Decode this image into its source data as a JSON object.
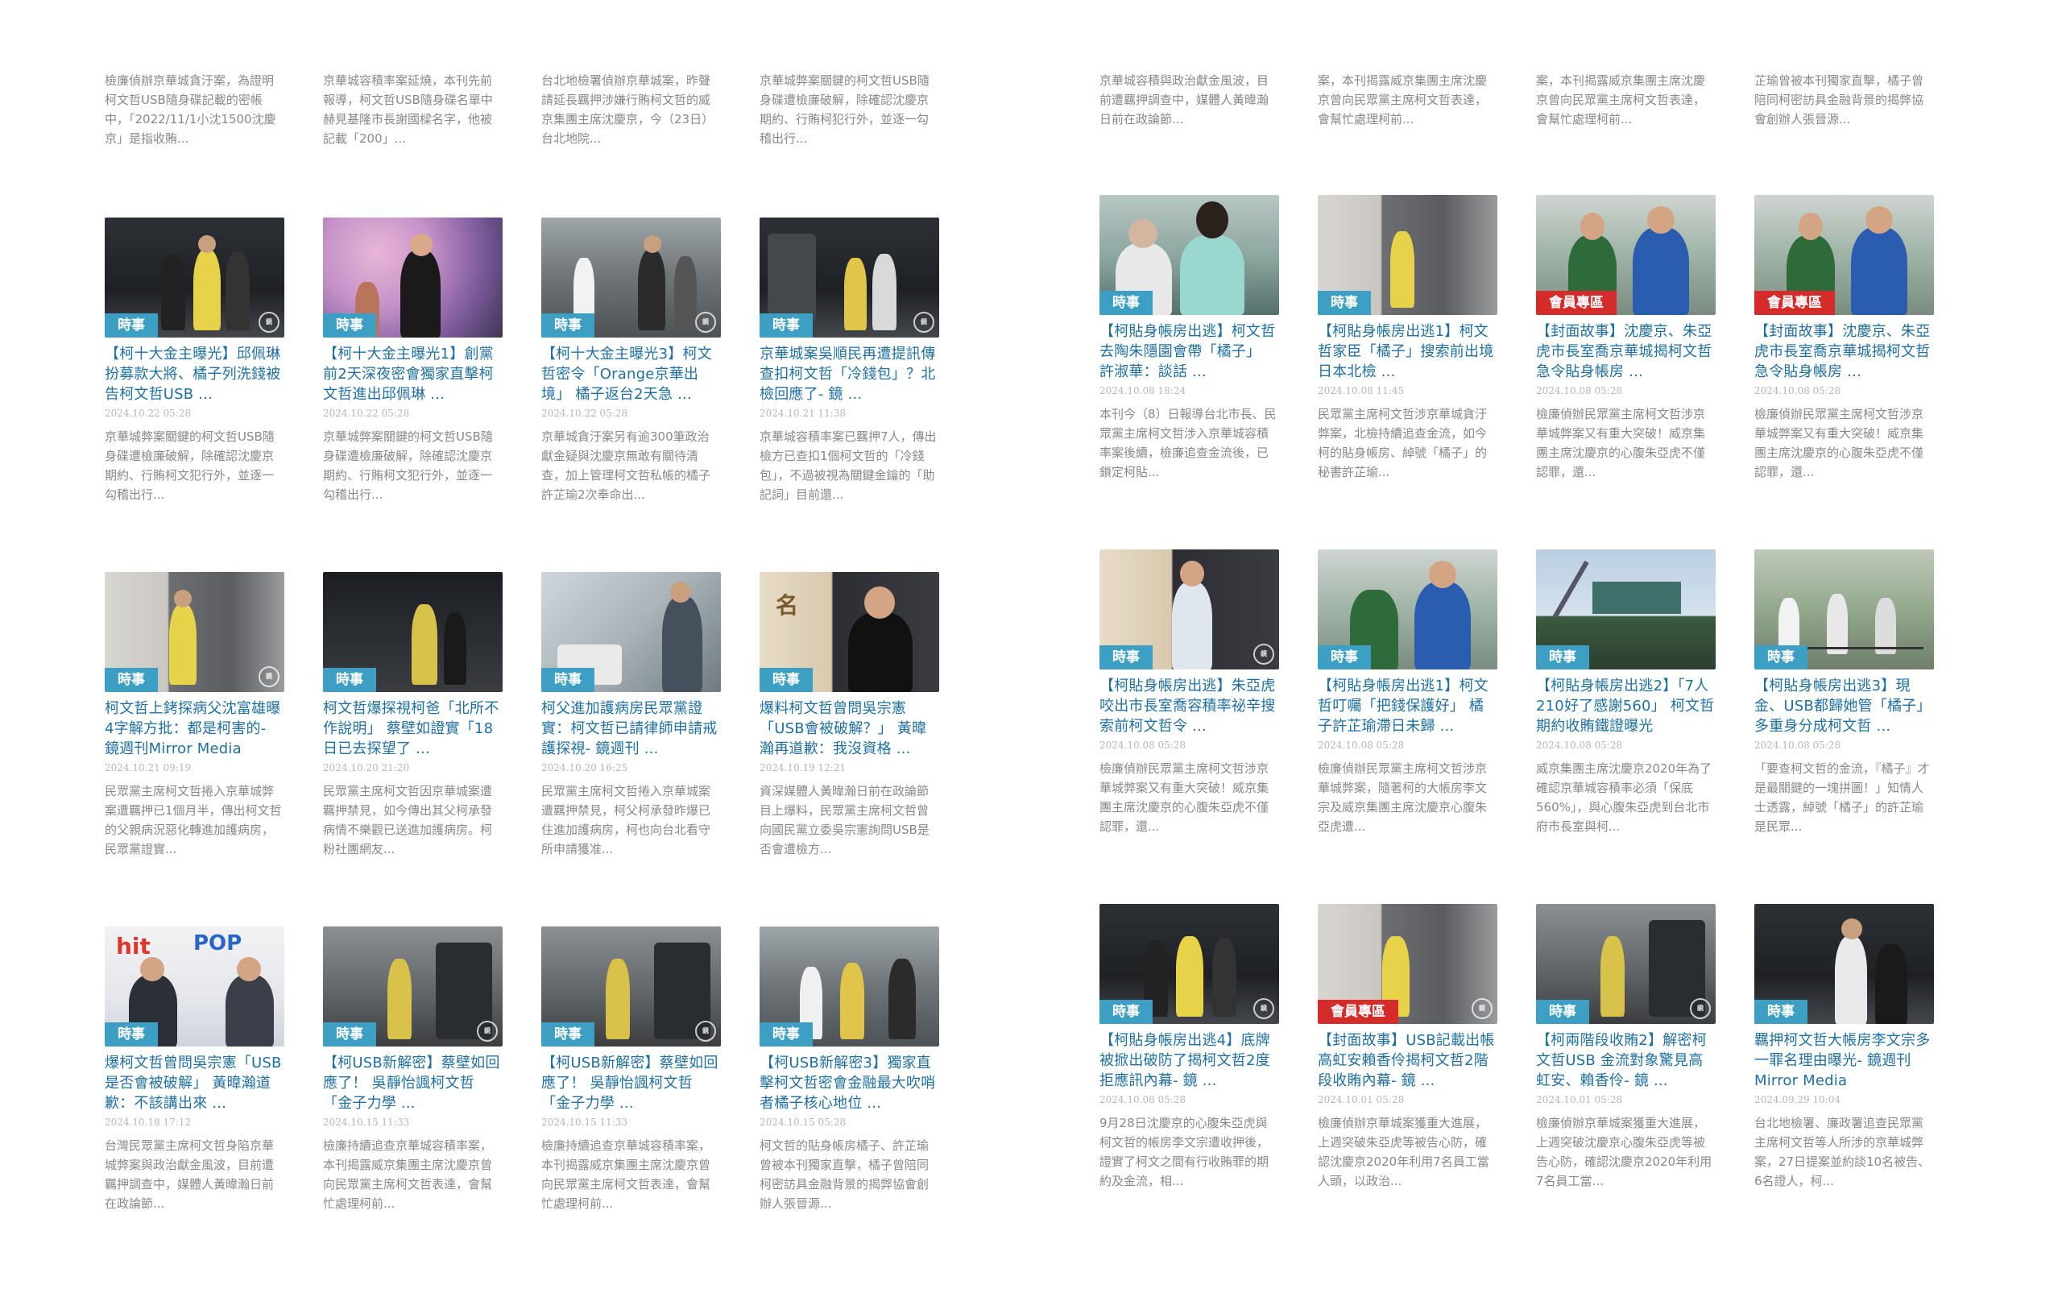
{
  "colors": {
    "category_badge": "#3d9fc4",
    "member_badge": "#d62b2b",
    "title": "#1f6fa3",
    "date": "#b5b5b5",
    "snippet": "#888888"
  },
  "left": {
    "row0": [
      {
        "snippet": "檢廉偵辦京華城貪汙案，為證明柯文哲USB隨身碟記載的密帳中，「2022/11/1小沈1500沈慶京」是指收賄..."
      },
      {
        "snippet": "京華城容積率案延燒，本刊先前報導，柯文哲USB隨身碟名單中赫見基隆市長謝國樑名字，他被記載「200」..."
      },
      {
        "snippet": "台北地檢署偵辦京華城案，昨聲請延長羈押涉嫌行賄柯文哲的威京集團主席沈慶京，今（23日）台北地院..."
      },
      {
        "snippet": "京華城弊案關鍵的柯文哲USB隨身碟遭檢廉破解，除確認沈慶京期約、行賄柯犯行外，並逐一勾稽出行..."
      }
    ],
    "row1": [
      {
        "badge": "時事",
        "title": "【柯十大金主曝光】邱佩琳扮募款大將、橘子列洗錢被告柯文哲USB ...",
        "date": "2024.10.22 05:28",
        "snippet": "京華城弊案關鍵的柯文哲USB隨身碟遭檢廉破解，除確認沈慶京期約、行賄柯文犯行外，並逐一勾稽出行..."
      },
      {
        "badge": "時事",
        "title": "【柯十大金主曝光1】創黨前2天深夜密會獨家直擊柯文哲進出邱佩琳 ...",
        "date": "2024.10.22 05:28",
        "snippet": "京華城弊案關鍵的柯文哲USB隨身碟遭檢廉破解，除確認沈慶京期約、行賄柯文犯行外，並逐一勾稽出行..."
      },
      {
        "badge": "時事",
        "title": "【柯十大金主曝光3】柯文哲密令「Orange京華出境」 橘子返台2天急 ...",
        "date": "2024.10.22 05:28",
        "snippet": "京華城貪汙案另有逾300筆政治獻金疑與沈慶京無敢有關待清查，加上管理柯文哲私帳的橘子許芷瑜2次奉命出..."
      },
      {
        "badge": "時事",
        "title": "京華城案吳順民再遭提訊傳查扣柯文哲「冷錢包」？北檢回應了- 鏡 ...",
        "date": "2024.10.21 11:38",
        "snippet": "京華城容積率案已羈押7人，傳出檢方已查扣1個柯文哲的「冷錢包」，不過被視為關鍵金鑰的「助記詞」目前還..."
      }
    ],
    "row2": [
      {
        "badge": "時事",
        "title": "柯文哲上銬探病父沈富雄曝4字解方批：都是柯害的- 鏡週刊Mirror Media",
        "date": "2024.10.21 09:19",
        "snippet": "民眾黨主席柯文哲捲入京華城弊案遭羈押已1個月半，傳出柯文哲的父親病況惡化轉進加護病房，民眾黨證實..."
      },
      {
        "badge": "時事",
        "title": "柯文哲爆探視柯爸「北所不作說明」 蔡壁如證實「18日已去探望了 ...",
        "date": "2024.10.20 21:20",
        "snippet": "民眾黨主席柯文哲因京華城案遭羈押禁見，如今傳出其父柯承發病情不樂觀已送進加護病房。柯粉社團網友..."
      },
      {
        "badge": "時事",
        "title": "柯父進加護病房民眾黨證實：柯文哲已請律師申請戒護探視- 鏡週刊 ...",
        "date": "2024.10.20 16:25",
        "snippet": "民眾黨主席柯文哲捲入京華城案遭羈押禁見，柯父柯承發昨爆已住進加護病房，柯也向台北看守所申請獲准..."
      },
      {
        "badge": "時事",
        "title": "爆料柯文哲曾問吳宗憲「USB會被破解？」 黃暐瀚再道歉：我沒資格 ...",
        "date": "2024.10.19 12:21",
        "snippet": "資深媒體人黃暐瀚日前在政論節目上爆料，民眾黨主席柯文哲曾向國民黨立委吳宗憲詢問USB是否會遭檢方..."
      }
    ],
    "row3": [
      {
        "badge": "時事",
        "title": "爆柯文哲曾問吳宗憲「USB是否會被破解」 黃暐瀚道歉：不該講出來 ...",
        "date": "2024.10.18 17:12",
        "snippet": "台灣民眾黨主席柯文哲身陷京華城弊案與政治獻金風波，目前遭羈押調查中，媒體人黃暐瀚日前在政論節..."
      },
      {
        "badge": "時事",
        "title": "【柯USB新解密】蔡壁如回應了！ 吳靜怡諷柯文哲「金子力學 ...",
        "date": "2024.10.15 11:33",
        "snippet": "檢廉持續追查京華城容積率案，本刊揭露威京集團主席沈慶京曾向民眾黨主席柯文哲表達，會幫忙處理柯前..."
      },
      {
        "badge": "時事",
        "title": "【柯USB新解密】蔡壁如回應了！ 吳靜怡諷柯文哲「金子力學 ...",
        "date": "2024.10.15 11:33",
        "snippet": "檢廉持續追查京華城容積率案，本刊揭露威京集團主席沈慶京曾向民眾黨主席柯文哲表達，會幫忙處理柯前..."
      },
      {
        "badge": "時事",
        "title": "【柯USB新解密3】獨家直擊柯文哲密會金融最大吹哨者橘子核心地位 ...",
        "date": "2024.10.15 05:28",
        "snippet": "柯文哲的貼身帳房橘子、許芷瑜曾被本刊獨家直擊，橘子曾陪同柯密訪具金融背景的揭弊協會創辦人張晉源..."
      }
    ]
  },
  "right": {
    "row0": [
      {
        "snippet": "京華城容積與政治獻金風波，目前遭羈押調查中，媒體人黃暐瀚日前在政論節..."
      },
      {
        "snippet": "案，本刊揭露威京集團主席沈慶京曾向民眾黨主席柯文哲表達，會幫忙處理柯前..."
      },
      {
        "snippet": "案，本刊揭露威京集團主席沈慶京曾向民眾黨主席柯文哲表達，會幫忙處理柯前..."
      },
      {
        "snippet": "芷瑜曾被本刊獨家直擊，橘子曾陪同柯密訪具金融背景的揭弊協會創辦人張晉源..."
      }
    ],
    "row1": [
      {
        "badge": "時事",
        "title": "【柯貼身帳房出逃】柯文哲去陶朱隱園會帶「橘子」 許淑華：談話 ...",
        "date": "2024.10.08 18:24",
        "snippet": "本刊今（8）日報導台北市長、民眾黨主席柯文哲涉入京華城容積率案後續，檢廉追查金流後，已鎖定柯貼..."
      },
      {
        "badge": "時事",
        "title": "【柯貼身帳房出逃1】柯文哲家臣「橘子」搜索前出境日本北檢 ...",
        "date": "2024.10.08 11:45",
        "snippet": "民眾黨主席柯文哲涉京華城貪汙弊案，北檢持續追查金流，如今柯的貼身帳房、綽號「橘子」的秘書許芷瑜..."
      },
      {
        "badge": "會員專區",
        "member": true,
        "title": "【封面故事】沈慶京、朱亞虎市長室喬京華城揭柯文哲急令貼身帳房 ...",
        "date": "2024.10.08 05:28",
        "snippet": "檢廉偵辦民眾黨主席柯文哲涉京華城弊案又有重大突破！威京集團主席沈慶京的心腹朱亞虎不僅認罪，還..."
      },
      {
        "badge": "會員專區",
        "member": true,
        "title": "【封面故事】沈慶京、朱亞虎市長室喬京華城揭柯文哲急令貼身帳房 ...",
        "date": "2024.10.08 05:28",
        "snippet": "檢廉偵辦民眾黨主席柯文哲涉京華城弊案又有重大突破！威京集團主席沈慶京的心腹朱亞虎不僅認罪，還..."
      }
    ],
    "row2": [
      {
        "badge": "時事",
        "title": "【柯貼身帳房出逃】朱亞虎咬出市長室喬容積率祕辛搜索前柯文哲令 ...",
        "date": "2024.10.08 05:28",
        "snippet": "檢廉偵辦民眾黨主席柯文哲涉京華城弊案又有重大突破！威京集團主席沈慶京的心腹朱亞虎不僅認罪，還..."
      },
      {
        "badge": "時事",
        "title": "【柯貼身帳房出逃1】柯文哲叮囑「把錢保護好」 橘子許芷瑜滯日未歸 ...",
        "date": "2024.10.08 05:28",
        "snippet": "檢廉偵辦民眾黨主席柯文哲涉京華城弊案，隨著柯的大帳房李文宗及威京集團主席沈慶京心腹朱亞虎遭..."
      },
      {
        "badge": "時事",
        "title": "【柯貼身帳房出逃2】「7人210好了感謝560」 柯文哲期約收賄鐵證曝光",
        "date": "2024.10.08 05:28",
        "snippet": "威京集團主席沈慶京2020年為了確認京華城容積率必須「保底560%」，與心腹朱亞虎到台北市府市長室與柯..."
      },
      {
        "badge": "時事",
        "title": "【柯貼身帳房出逃3】現金、USB都歸她管「橘子」多重身分成柯文哲 ...",
        "date": "2024.10.08 05:28",
        "snippet": "「要查柯文哲的金流，『橘子』才是最關鍵的一塊拼圖！」知情人士透露，綽號「橘子」的許芷瑜是民眾..."
      }
    ],
    "row3": [
      {
        "badge": "時事",
        "title": "【柯貼身帳房出逃4】底牌被掀出破防了揭柯文哲2度拒應訊內幕- 鏡 ...",
        "date": "2024.10.08 05:28",
        "snippet": "9月28日沈慶京的心腹朱亞虎與柯文哲的帳房李文宗遭收押後，證實了柯文之間有行收賄罪的期約及金流，相..."
      },
      {
        "badge": "會員專區",
        "member": true,
        "title": "【封面故事】USB記載出帳高虹安賴香伶揭柯文哲2階段收賄內幕- 鏡 ...",
        "date": "2024.10.01 05:28",
        "snippet": "檢廉偵辦京華城案獲重大進展，上週突破朱亞虎等被告心防，確認沈慶京2020年利用7名員工當人頭，以政治..."
      },
      {
        "badge": "時事",
        "title": "【柯兩階段收賄2】解密柯文哲USB 金流對象驚見高虹安、賴香伶- 鏡 ...",
        "date": "2024.10.01 05:28",
        "snippet": "檢廉偵辦京華城案獲重大進展，上週突破沈慶京心腹朱亞虎等被告心防，確認沈慶京2020年利用7名員工當..."
      },
      {
        "badge": "時事",
        "title": "羈押柯文哲大帳房李文宗多一罪名理由曝光- 鏡週刊Mirror Media",
        "date": "2024.09.29 10:04",
        "snippet": "台北地檢署、廉政署追查民眾黨主席柯文哲等人所涉的京華城弊案，27日提案並約談10名被告、6名證人，柯..."
      }
    ]
  },
  "icons": {
    "watermark": "mirror-watermark-icon"
  }
}
